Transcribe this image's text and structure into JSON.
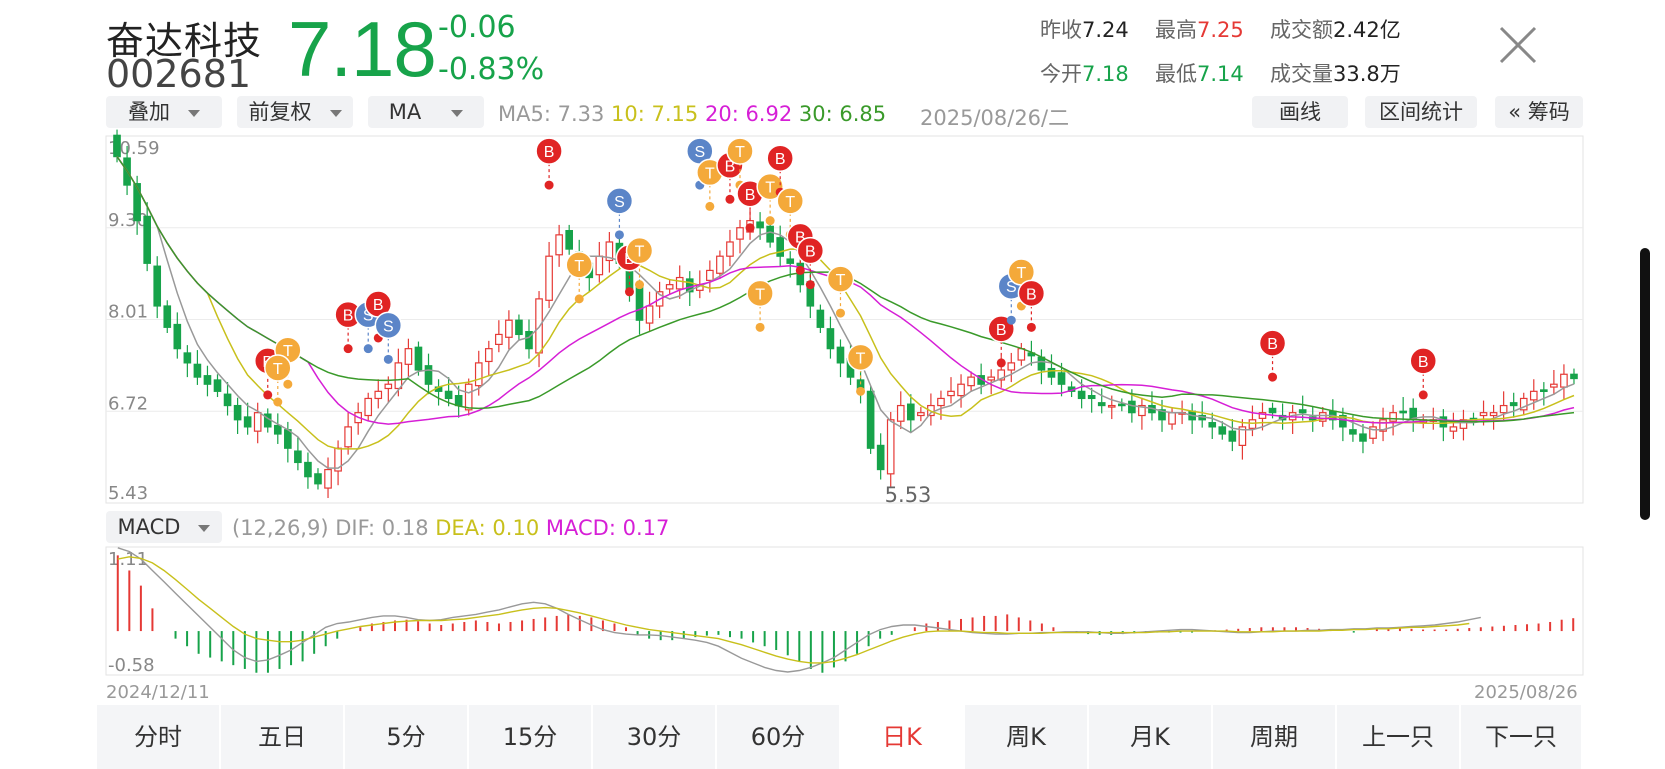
{
  "header": {
    "name": "奋达科技",
    "code": "002681",
    "price": "7.18",
    "change": "-0.06",
    "change_pct": "-0.83%",
    "quotes": [
      {
        "label": "昨收",
        "value": "7.24",
        "tone": "dark"
      },
      {
        "label": "最高",
        "value": "7.25",
        "tone": "red"
      },
      {
        "label": "成交额",
        "value": "2.42亿",
        "tone": "dark"
      },
      {
        "label": "今开",
        "value": "7.18",
        "tone": "green"
      },
      {
        "label": "最低",
        "value": "7.14",
        "tone": "green"
      },
      {
        "label": "成交量",
        "value": "33.8万",
        "tone": "dark"
      }
    ],
    "close_icon": "close-icon"
  },
  "toolbar": {
    "overlay": "叠加",
    "adjust": "前复权",
    "indicator": "MA",
    "ma": [
      {
        "text": "MA5: 7.33",
        "color": "#999999"
      },
      {
        "text": "10: 7.15",
        "color": "#c8c01c"
      },
      {
        "text": "20: 6.92",
        "color": "#d61fd6"
      },
      {
        "text": "30: 6.85",
        "color": "#3a9a2a"
      }
    ],
    "date": "2025/08/26/二",
    "draw": "画线",
    "range_stats": "区间统计",
    "chips": "« 筹码"
  },
  "macd_bar": {
    "indicator": "MACD",
    "params": "(12,26,9)",
    "dif": "DIF: 0.18",
    "dea": "DEA: 0.10",
    "macd": "MACD: 0.17"
  },
  "dates": {
    "start": "2024/12/11",
    "end": "2025/08/26"
  },
  "colors": {
    "up": "#e53935",
    "down": "#17a34a",
    "ma5": "#999999",
    "ma10": "#c8c01c",
    "ma20": "#d61fd6",
    "ma30": "#3a9a2a",
    "marker_b": "#e02424",
    "marker_s": "#5b85c8",
    "marker_t": "#f4a93a"
  },
  "tabs": [
    {
      "label": "分时"
    },
    {
      "label": "五日"
    },
    {
      "label": "5分"
    },
    {
      "label": "15分"
    },
    {
      "label": "30分"
    },
    {
      "label": "60分"
    },
    {
      "label": "日K",
      "active": true
    },
    {
      "label": "周K"
    },
    {
      "label": "月K"
    },
    {
      "label": "周期"
    },
    {
      "label": "上一只"
    },
    {
      "label": "下一只"
    }
  ],
  "chart_data": [
    {
      "type": "candlestick",
      "ylim": [
        5.43,
        10.59
      ],
      "yticks": [
        "10.59",
        "9.30",
        "8.01",
        "6.72",
        "5.43"
      ],
      "low_label": "5.53",
      "close_series": [
        10.3,
        9.9,
        9.4,
        8.8,
        8.2,
        7.9,
        7.6,
        7.4,
        7.2,
        7.1,
        7.0,
        6.8,
        6.6,
        6.5,
        6.7,
        6.5,
        6.4,
        6.2,
        6.0,
        5.8,
        5.7,
        5.9,
        6.2,
        6.5,
        6.7,
        6.9,
        7.0,
        7.1,
        7.4,
        7.6,
        7.3,
        7.1,
        7.0,
        6.9,
        6.8,
        7.1,
        7.4,
        7.6,
        7.8,
        8.0,
        7.8,
        7.6,
        8.3,
        8.9,
        9.2,
        9.0,
        8.8,
        8.6,
        8.9,
        9.1,
        8.8,
        8.4,
        8.0,
        8.2,
        8.4,
        8.5,
        8.6,
        8.4,
        8.5,
        8.7,
        8.9,
        9.1,
        9.3,
        9.4,
        9.3,
        9.1,
        8.9,
        8.8,
        8.5,
        8.2,
        7.9,
        7.6,
        7.4,
        7.2,
        7.0,
        6.2,
        5.9,
        6.6,
        6.8,
        6.6,
        6.7,
        6.8,
        6.9,
        7.0,
        7.1,
        7.2,
        7.1,
        7.2,
        7.3,
        7.4,
        7.6,
        7.5,
        7.3,
        7.2,
        7.1,
        7.0,
        6.9,
        6.9,
        6.8,
        6.8,
        6.8,
        6.7,
        6.8,
        6.7,
        6.6,
        6.7,
        6.7,
        6.6,
        6.6,
        6.5,
        6.4,
        6.3,
        6.5,
        6.6,
        6.7,
        6.7,
        6.6,
        6.7,
        6.7,
        6.6,
        6.7,
        6.6,
        6.5,
        6.4,
        6.3,
        6.5,
        6.6,
        6.7,
        6.7,
        6.6,
        6.6,
        6.6,
        6.5,
        6.5,
        6.6,
        6.6,
        6.7,
        6.7,
        6.8,
        6.8,
        6.9,
        7.0,
        7.0,
        7.1,
        7.24,
        7.18
      ],
      "markers": [
        {
          "label": "B",
          "i": 15,
          "price": 6.95
        },
        {
          "label": "T",
          "i": 17,
          "price": 7.1
        },
        {
          "label": "T",
          "i": 16,
          "price": 6.85
        },
        {
          "label": "B",
          "i": 23,
          "price": 7.6
        },
        {
          "label": "S",
          "i": 25,
          "price": 7.6
        },
        {
          "label": "B",
          "i": 26,
          "price": 7.75
        },
        {
          "label": "S",
          "i": 27,
          "price": 7.45
        },
        {
          "label": "B",
          "i": 43,
          "price": 9.9
        },
        {
          "label": "T",
          "i": 46,
          "price": 8.3
        },
        {
          "label": "S",
          "i": 50,
          "price": 9.2
        },
        {
          "label": "B",
          "i": 51,
          "price": 8.4
        },
        {
          "label": "T",
          "i": 52,
          "price": 8.5
        },
        {
          "label": "S",
          "i": 58,
          "price": 9.9
        },
        {
          "label": "T",
          "i": 59,
          "price": 9.6
        },
        {
          "label": "B",
          "i": 61,
          "price": 9.7
        },
        {
          "label": "T",
          "i": 62,
          "price": 9.9
        },
        {
          "label": "T",
          "i": 64,
          "price": 7.9
        },
        {
          "label": "B",
          "i": 63,
          "price": 9.3
        },
        {
          "label": "T",
          "i": 65,
          "price": 9.4
        },
        {
          "label": "B",
          "i": 66,
          "price": 9.8
        },
        {
          "label": "T",
          "i": 67,
          "price": 9.2
        },
        {
          "label": "B",
          "i": 68,
          "price": 8.7
        },
        {
          "label": "B",
          "i": 69,
          "price": 8.5
        },
        {
          "label": "T",
          "i": 72,
          "price": 8.1
        },
        {
          "label": "T",
          "i": 74,
          "price": 7.0
        },
        {
          "label": "B",
          "i": 88,
          "price": 7.4
        },
        {
          "label": "S",
          "i": 89,
          "price": 8.0
        },
        {
          "label": "T",
          "i": 90,
          "price": 8.2
        },
        {
          "label": "B",
          "i": 91,
          "price": 7.9
        },
        {
          "label": "B",
          "i": 115,
          "price": 7.2
        },
        {
          "label": "B",
          "i": 130,
          "price": 6.95
        }
      ]
    },
    {
      "type": "bar",
      "series": [
        {
          "name": "MACD"
        },
        {
          "name": "DIF"
        },
        {
          "name": "DEA"
        }
      ],
      "ylim": [
        -0.58,
        1.11
      ],
      "yticks": [
        "1.11",
        "-0.58"
      ],
      "macd_values": [
        1.0,
        0.8,
        0.6,
        0.3,
        0.0,
        -0.1,
        -0.2,
        -0.3,
        -0.35,
        -0.4,
        -0.45,
        -0.5,
        -0.55,
        -0.55,
        -0.5,
        -0.45,
        -0.4,
        -0.3,
        -0.2,
        -0.1,
        0.0,
        0.05,
        0.1,
        0.12,
        0.14,
        0.15,
        0.13,
        0.1,
        0.08,
        0.1,
        0.12,
        0.14,
        0.12,
        0.1,
        0.12,
        0.14,
        0.16,
        0.18,
        0.2,
        0.22,
        0.2,
        0.18,
        0.14,
        0.1,
        0.05,
        -0.05,
        -0.1,
        -0.12,
        -0.12,
        -0.1,
        -0.08,
        -0.06,
        -0.05,
        -0.08,
        -0.1,
        -0.15,
        -0.2,
        -0.25,
        -0.32,
        -0.4,
        -0.5,
        -0.55,
        -0.48,
        -0.4,
        -0.3,
        -0.2,
        -0.1,
        -0.05,
        0.0,
        0.05,
        0.1,
        0.12,
        0.14,
        0.16,
        0.18,
        0.2,
        0.2,
        0.22,
        0.18,
        0.14,
        0.1,
        0.05,
        0.0,
        -0.02,
        -0.04,
        -0.05,
        -0.05,
        -0.04,
        -0.03,
        -0.02,
        -0.02,
        -0.02,
        -0.02,
        -0.02,
        0.0,
        0.01,
        0.02,
        0.03,
        0.04,
        0.05,
        0.05,
        0.05,
        0.05,
        0.04,
        0.03,
        0.02,
        0.0,
        -0.02,
        0.0,
        0.03,
        0.04,
        0.04,
        0.03,
        0.02,
        0.02,
        0.02,
        0.03,
        0.04,
        0.05,
        0.06,
        0.07,
        0.08,
        0.09,
        0.1,
        0.12,
        0.15,
        0.17
      ],
      "dif_values": [
        1.1,
        1.05,
        0.95,
        0.8,
        0.65,
        0.5,
        0.35,
        0.2,
        0.05,
        -0.1,
        -0.25,
        -0.35,
        -0.4,
        -0.38,
        -0.32,
        -0.25,
        -0.15,
        -0.05,
        0.05,
        0.1,
        0.12,
        0.15,
        0.18,
        0.2,
        0.2,
        0.18,
        0.15,
        0.14,
        0.15,
        0.18,
        0.2,
        0.22,
        0.25,
        0.28,
        0.32,
        0.36,
        0.38,
        0.36,
        0.3,
        0.22,
        0.15,
        0.08,
        0.02,
        -0.02,
        -0.04,
        -0.05,
        -0.05,
        -0.06,
        -0.08,
        -0.1,
        -0.12,
        -0.15,
        -0.2,
        -0.28,
        -0.36,
        -0.42,
        -0.48,
        -0.52,
        -0.54,
        -0.52,
        -0.48,
        -0.42,
        -0.35,
        -0.25,
        -0.15,
        -0.05,
        0.02,
        0.06,
        0.08,
        0.08,
        0.06,
        0.04,
        0.02,
        0.0,
        -0.02,
        -0.03,
        -0.04,
        -0.04,
        -0.03,
        -0.03,
        -0.02,
        -0.02,
        -0.01,
        -0.01,
        -0.01,
        -0.02,
        -0.03,
        -0.03,
        -0.02,
        -0.01,
        0.0,
        0.01,
        0.02,
        0.02,
        0.01,
        0.0,
        -0.01,
        -0.02,
        -0.02,
        -0.01,
        0.0,
        0.0,
        0.0,
        0.01,
        0.01,
        0.02,
        0.02,
        0.03,
        0.03,
        0.04,
        0.04,
        0.05,
        0.06,
        0.07,
        0.08,
        0.1,
        0.12,
        0.15,
        0.18
      ],
      "dea_values": [
        0.95,
        0.98,
        0.96,
        0.9,
        0.8,
        0.68,
        0.55,
        0.42,
        0.3,
        0.18,
        0.06,
        -0.04,
        -0.1,
        -0.12,
        -0.14,
        -0.14,
        -0.12,
        -0.08,
        -0.04,
        0.0,
        0.03,
        0.06,
        0.08,
        0.1,
        0.12,
        0.13,
        0.14,
        0.14,
        0.14,
        0.15,
        0.16,
        0.18,
        0.2,
        0.22,
        0.25,
        0.28,
        0.3,
        0.31,
        0.3,
        0.27,
        0.24,
        0.2,
        0.16,
        0.12,
        0.08,
        0.05,
        0.02,
        0.0,
        -0.02,
        -0.04,
        -0.06,
        -0.08,
        -0.1,
        -0.14,
        -0.18,
        -0.23,
        -0.28,
        -0.33,
        -0.37,
        -0.4,
        -0.42,
        -0.42,
        -0.4,
        -0.36,
        -0.31,
        -0.25,
        -0.19,
        -0.13,
        -0.08,
        -0.04,
        -0.01,
        0.0,
        0.0,
        0.0,
        -0.01,
        -0.02,
        -0.02,
        -0.03,
        -0.03,
        -0.03,
        -0.03,
        -0.02,
        -0.02,
        -0.02,
        -0.02,
        -0.02,
        -0.02,
        -0.02,
        -0.02,
        -0.02,
        -0.01,
        -0.01,
        0.0,
        0.0,
        0.0,
        0.0,
        0.0,
        -0.01,
        -0.01,
        -0.01,
        -0.01,
        0.0,
        0.0,
        0.0,
        0.0,
        0.01,
        0.01,
        0.02,
        0.02,
        0.03,
        0.03,
        0.04,
        0.05,
        0.05,
        0.06,
        0.07,
        0.08,
        0.1
      ]
    }
  ]
}
